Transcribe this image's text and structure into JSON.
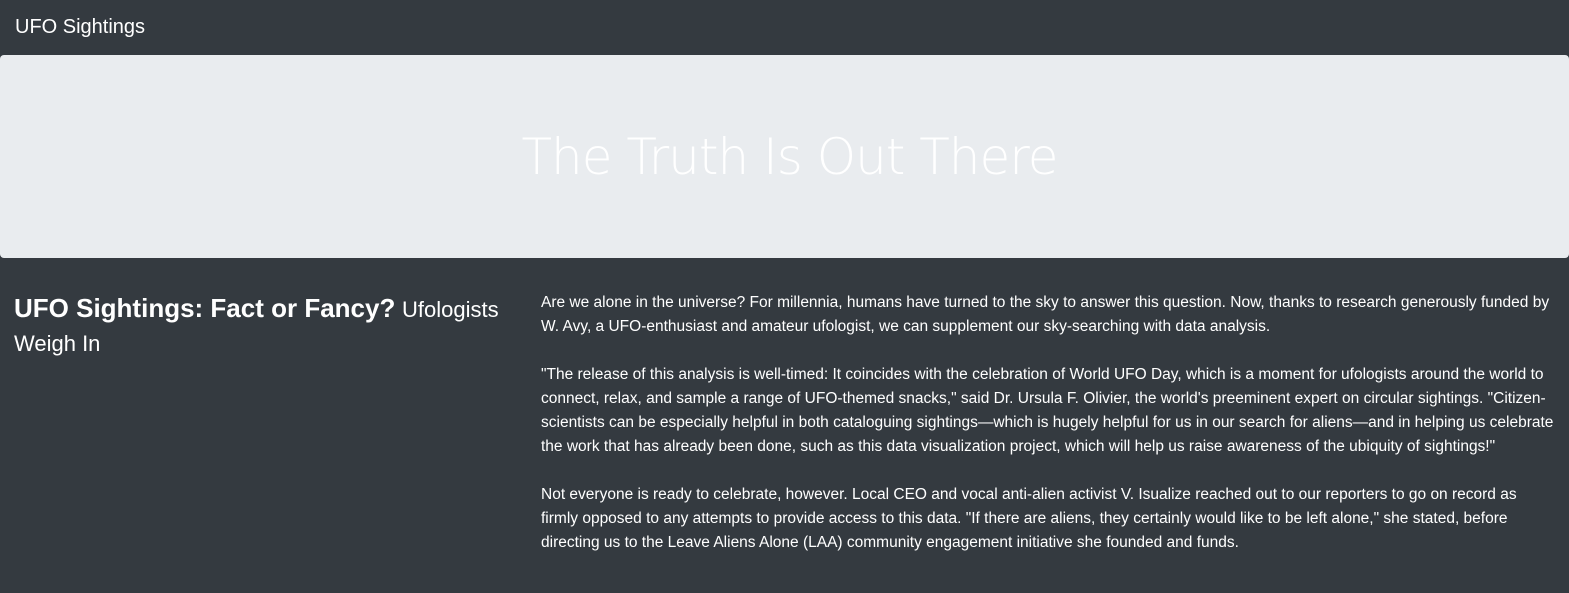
{
  "navbar": {
    "brand": "UFO Sightings"
  },
  "hero": {
    "title": "The Truth Is Out There"
  },
  "article": {
    "heading_main": "UFO Sightings: Fact or Fancy?",
    "heading_sub": "Ufologists Weigh In",
    "paragraphs": [
      "Are we alone in the universe? For millennia, humans have turned to the sky to answer this question. Now, thanks to research generously funded by W. Avy, a UFO-enthusiast and amateur ufologist, we can supplement our sky-searching with data analysis.",
      "\"The release of this analysis is well-timed: It coincides with the celebration of World UFO Day, which is a moment for ufologists around the world to connect, relax, and sample a range of UFO-themed snacks,\" said Dr. Ursula F. Olivier, the world's preeminent expert on circular sightings. \"Citizen-scientists can be especially helpful in both cataloguing sightings—which is hugely helpful for us in our search for aliens—and in helping us celebrate the work that has already been done, such as this data visualization project, which will help us raise awareness of the ubiquity of sightings!\"",
      "Not everyone is ready to celebrate, however. Local CEO and vocal anti-alien activist V. Isualize reached out to our reporters to go on record as firmly opposed to any attempts to provide access to this data. \"If there are aliens, they certainly would like to be left alone,\" she stated, before directing us to the Leave Aliens Alone (LAA) community engagement initiative she founded and funds."
    ]
  },
  "colors": {
    "background": "#343a40",
    "hero_background": "#e9ecef",
    "text": "#ffffff"
  }
}
